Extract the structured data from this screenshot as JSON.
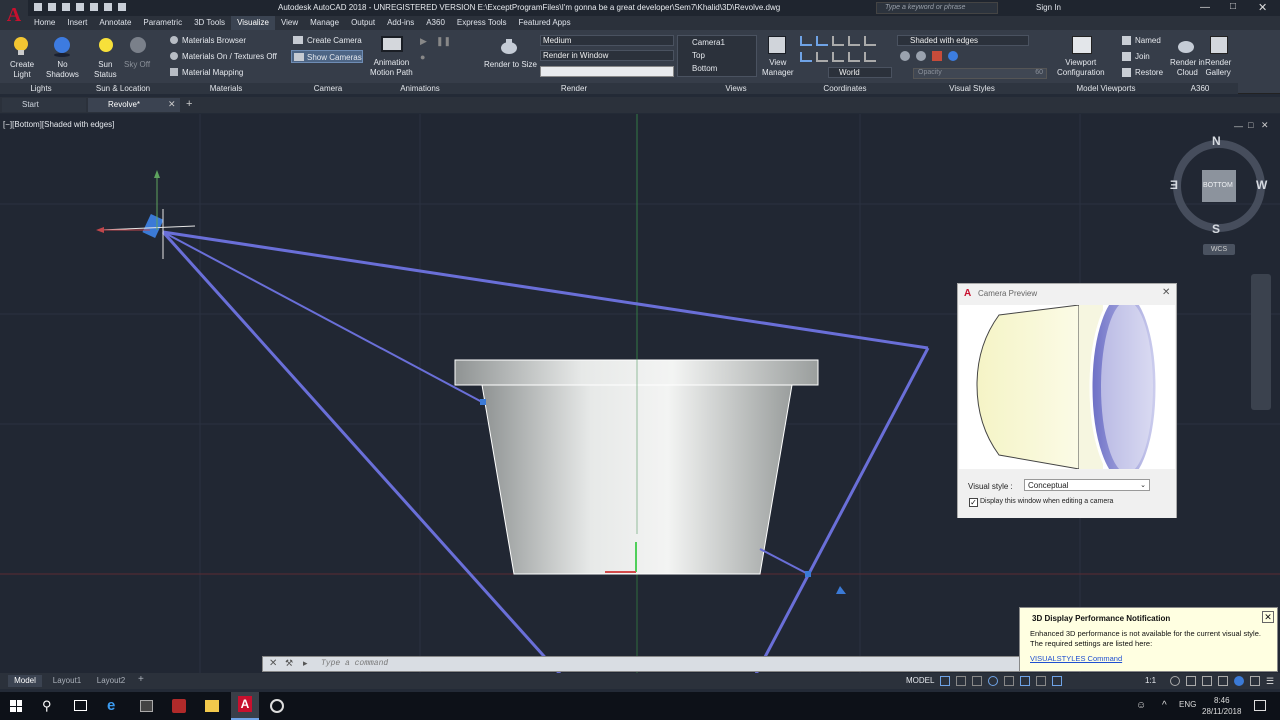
{
  "title": {
    "text": "Autodesk AutoCAD 2018 - UNREGISTERED VERSION    E:\\ExceptProgramFiles\\I'm gonna be a great developer\\Sem7\\Khalid\\3D\\Revolve.dwg",
    "search_placeholder": "Type a keyword or phrase",
    "signin": "Sign In"
  },
  "app_letter": "A",
  "menu_tabs": [
    "Home",
    "Insert",
    "Annotate",
    "Parametric",
    "3D Tools",
    "Visualize",
    "View",
    "Manage",
    "Output",
    "Add-ins",
    "A360",
    "Express Tools",
    "Featured Apps"
  ],
  "ribbon": {
    "lights": {
      "create_light": "Create\nLight",
      "no_shadows": "No\nShadows",
      "sun_status": "Sun\nStatus",
      "sky_off": "Sky Off"
    },
    "materials": {
      "browser": "Materials Browser",
      "on_textures": "Materials On / Textures Off",
      "mapping": "Material Mapping"
    },
    "camera": {
      "create": "Create Camera",
      "show": "Show Cameras"
    },
    "animations": {
      "motion_path": "Animation\nMotion Path"
    },
    "render": {
      "render_to_size": "Render to Size",
      "quality": "Medium",
      "target": "Render in Window"
    },
    "views": {
      "items": [
        "Camera1",
        "Top",
        "Bottom"
      ],
      "view_manager": "View\nManager"
    },
    "coordinates": {
      "world": "World"
    },
    "visual_styles": {
      "current": "Shaded with edges",
      "opacity_label": "Opacity",
      "opacity_value": "60"
    },
    "model_viewports": {
      "config": "Viewport\nConfiguration",
      "named": "Named",
      "join": "Join",
      "restore": "Restore"
    },
    "a360": {
      "render_in_cloud": "Render in\nCloud",
      "render_gallery": "Render\nGallery"
    },
    "panels": [
      "Lights",
      "Sun & Location",
      "Materials",
      "Camera",
      "Animations",
      "Render",
      "Views",
      "Coordinates",
      "Visual Styles",
      "Model Viewports",
      "A360"
    ]
  },
  "doc_tabs": {
    "start": "Start",
    "active": "Revolve*"
  },
  "viewport_label": "[−][Bottom][Shaded with edges]",
  "viewcube": {
    "n": "N",
    "s": "S",
    "e": "E",
    "w": "W",
    "face": "BOTTOM",
    "wcs": "WCS"
  },
  "camera_preview": {
    "title": "Camera Preview",
    "visual_style_label": "Visual style :",
    "visual_style_value": "Conceptual",
    "checkbox_label": "Display this window when editing a camera",
    "checked": true
  },
  "notification": {
    "title": "3D Display Performance Notification",
    "body": "Enhanced 3D performance is not available for the current visual style. The required settings are listed here:",
    "link": "VISUALSTYLES Command"
  },
  "command_placeholder": "Type a command",
  "layout_tabs": [
    "Model",
    "Layout1",
    "Layout2"
  ],
  "status": {
    "model": "MODEL",
    "scale": "1:1"
  },
  "taskbar": {
    "lang": "ENG",
    "time": "8:46",
    "date": "28/11/2018"
  },
  "colors": {
    "accent": "#3b7ad6",
    "canvas": "#212733",
    "app_red": "#c8102e",
    "camera_line": "#6a6fd8"
  }
}
